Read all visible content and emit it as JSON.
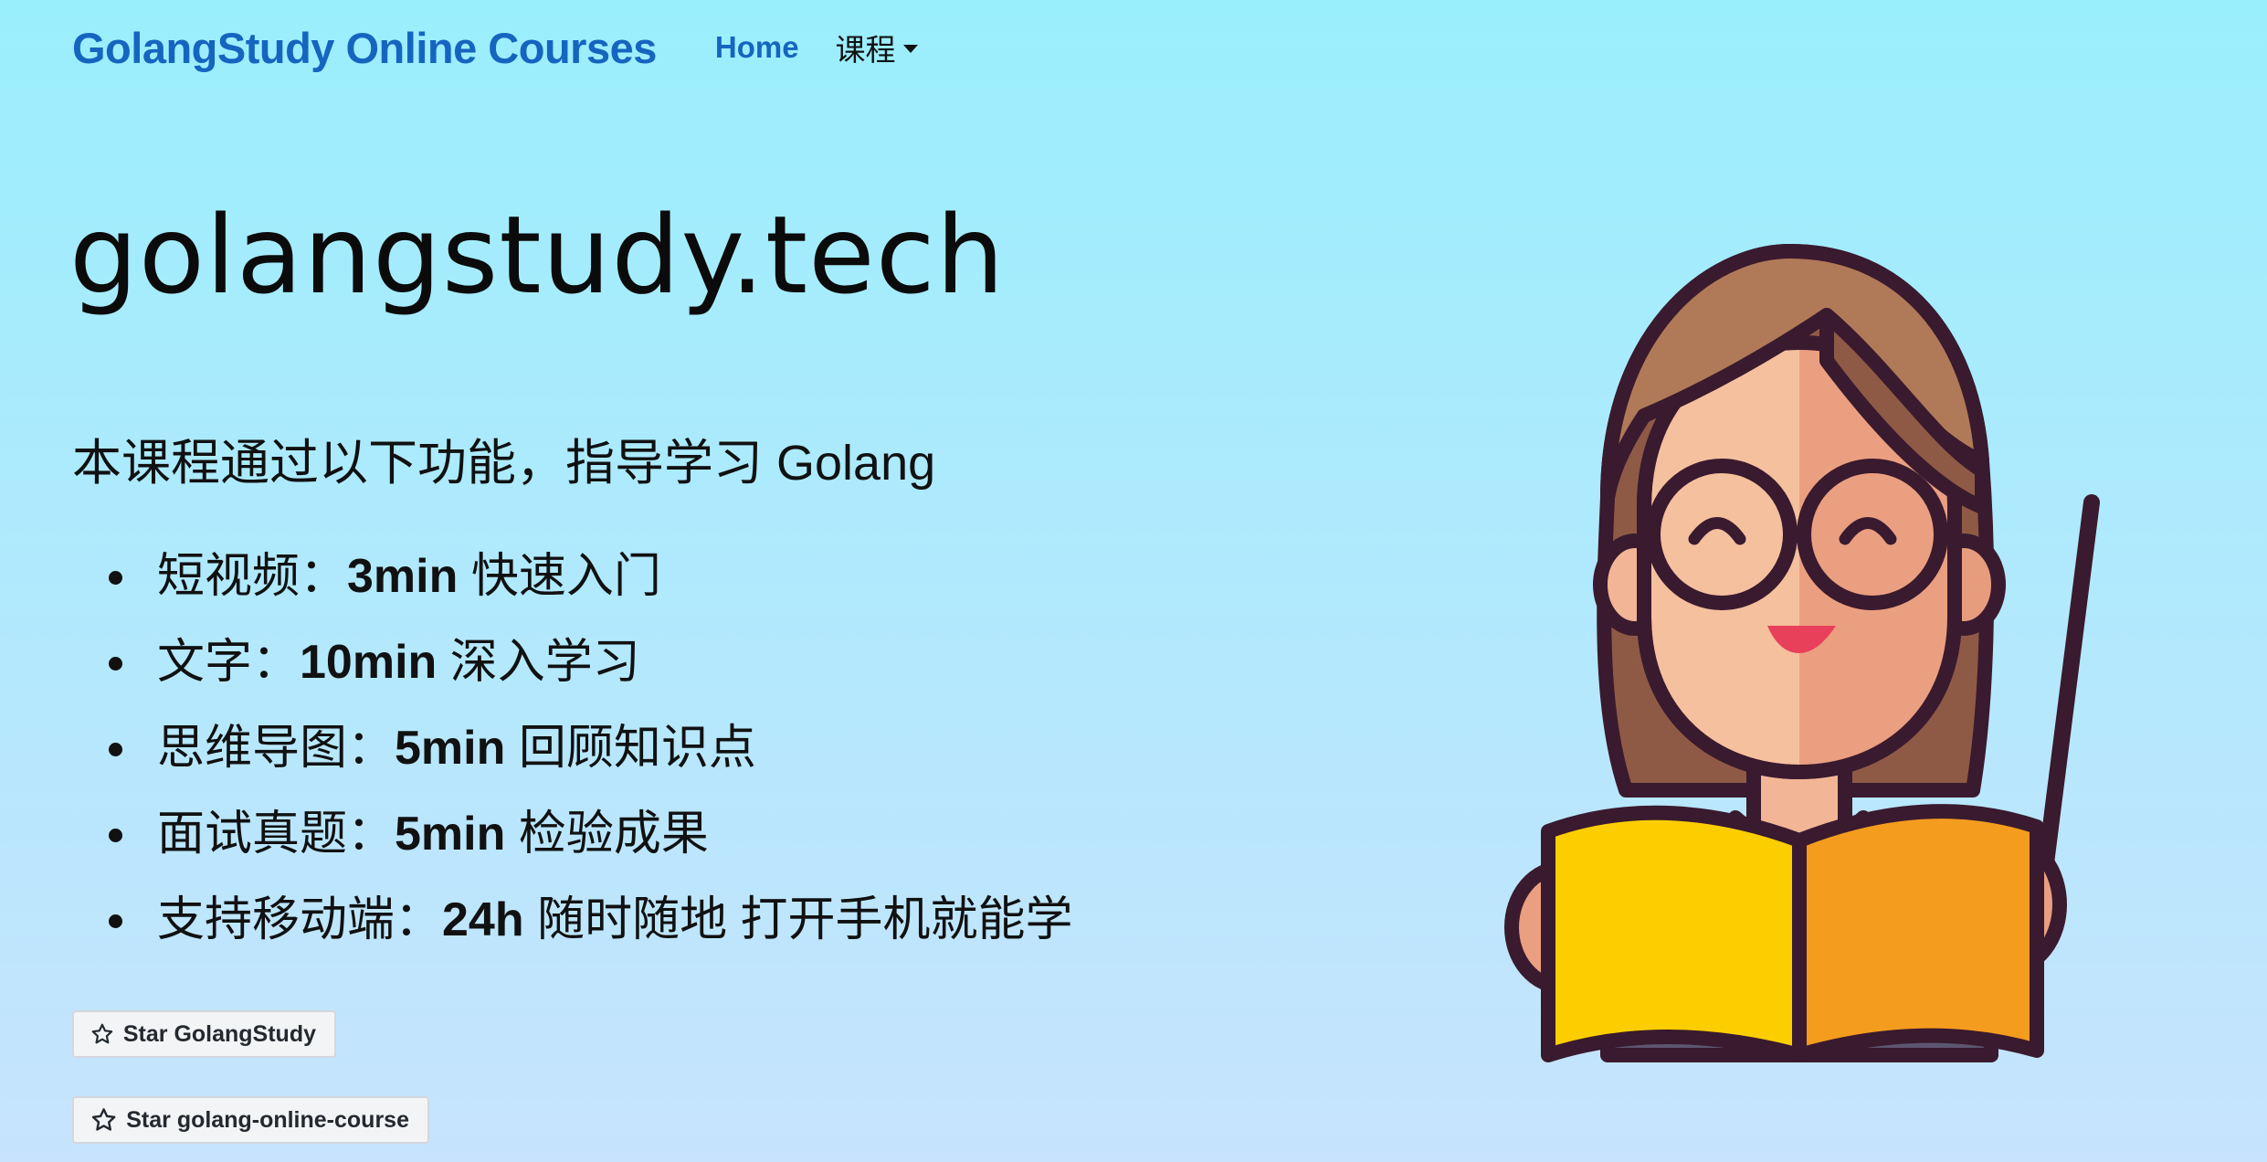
{
  "nav": {
    "brand": "GolangStudy Online Courses",
    "items": [
      {
        "label": "Home",
        "active": true
      },
      {
        "label": "课程",
        "dropdown": true
      }
    ]
  },
  "hero": {
    "title": "golangstudy.tech",
    "lead": "本课程通过以下功能，指导学习 Golang",
    "features": [
      {
        "name": "短视频：",
        "highlight": "3min",
        "desc": " 快速入门"
      },
      {
        "name": "文字：",
        "highlight": "10min",
        "desc": " 深入学习"
      },
      {
        "name": "思维导图：",
        "highlight": "5min",
        "desc": " 回顾知识点"
      },
      {
        "name": "面试真题：",
        "highlight": "5min",
        "desc": " 检验成果"
      },
      {
        "name": "支持移动端：",
        "highlight": "24h",
        "desc": " 随时随地 打开手机就能学"
      }
    ]
  },
  "buttons": {
    "star1": "Star GolangStudy",
    "star2": "Star golang-online-course"
  },
  "icons": {
    "star": "star-outline-icon",
    "illustration": "teacher-illustration"
  },
  "colors": {
    "brand": "#1565c0",
    "bg_top": "#9aeffd",
    "bg_bottom": "#c7e3fd"
  }
}
